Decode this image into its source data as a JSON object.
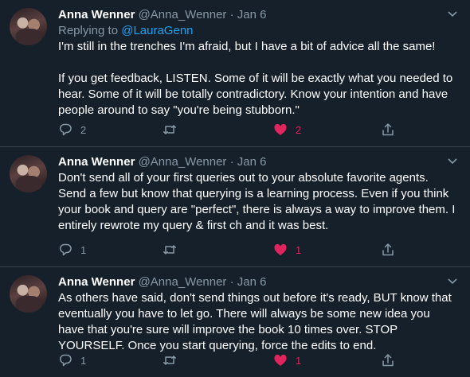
{
  "tweets": [
    {
      "name": "Anna Wenner",
      "handle": "@Anna_Wenner",
      "sep": "·",
      "date": "Jan 6",
      "reply_prefix": "Replying to ",
      "reply_to": "@LauraGenn",
      "paragraphs": [
        "I'm still in the trenches I'm afraid, but I have a bit of advice all the same!",
        "If you get feedback, LISTEN. Some of it will be exactly what you needed to hear. Some of it will be totally contradictory. Know your intention and have people around to say \"you're being stubborn.\""
      ],
      "replies": "2",
      "retweets": "",
      "likes": "2"
    },
    {
      "name": "Anna Wenner",
      "handle": "@Anna_Wenner",
      "sep": "·",
      "date": "Jan 6",
      "paragraphs": [
        "Don't send all of your first queries out to your absolute favorite agents. Send a few but know that querying is a learning process. Even if you think your book and query are \"perfect\", there is always a way to improve them. I entirely rewrote my query & first ch and it was best."
      ],
      "replies": "1",
      "retweets": "",
      "likes": "1"
    },
    {
      "name": "Anna Wenner",
      "handle": "@Anna_Wenner",
      "sep": "·",
      "date": "Jan 6",
      "paragraphs": [
        "As others have said, don't send things out before it's ready, BUT know that eventually you have to let go. There will always be some new idea you have that you're sure will improve the book 10 times over. STOP YOURSELF. Once you start querying, force the edits to end."
      ],
      "replies": "1",
      "retweets": "",
      "likes": "1"
    }
  ],
  "icons": {
    "reply": "reply-icon",
    "retweet": "retweet-icon",
    "like": "heart-icon",
    "share": "share-icon",
    "menu": "chevron-down-icon"
  },
  "colors": {
    "background": "#15202b",
    "muted": "#8899a6",
    "link": "#1da1f2",
    "like": "#e0245e",
    "divider": "#38444d"
  }
}
